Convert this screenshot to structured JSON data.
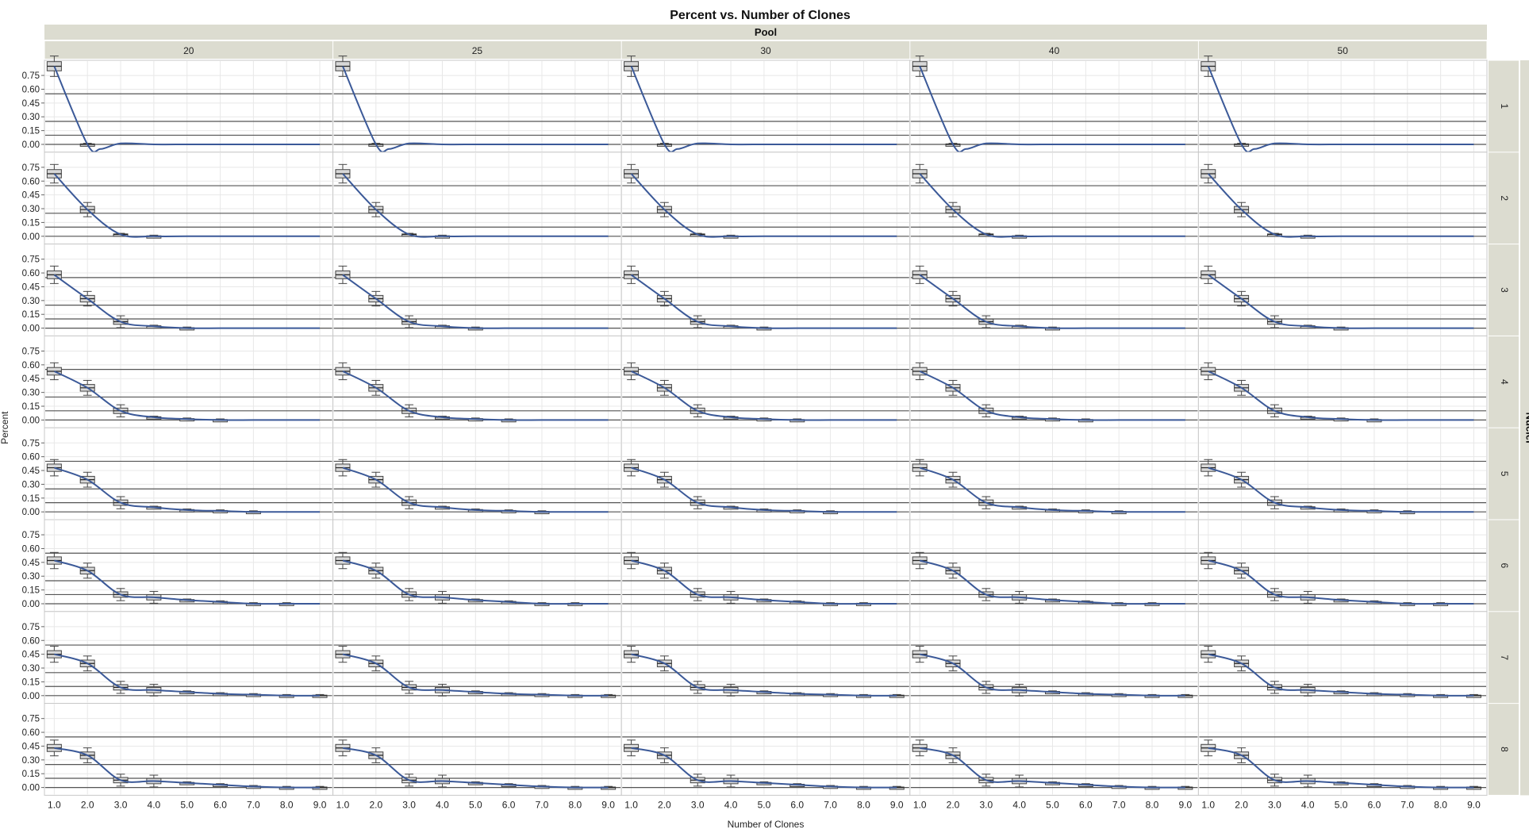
{
  "chart_data": {
    "type": "line",
    "title": "Percent vs. Number of Clones",
    "xlabel": "Number of Clones",
    "ylabel": "Percent",
    "column_group_label": "Pool",
    "row_group_label": "Nuclei",
    "columns": [
      "20",
      "25",
      "30",
      "40",
      "50"
    ],
    "rows": [
      "1",
      "2",
      "3",
      "4",
      "5",
      "6",
      "7",
      "8"
    ],
    "x_ticks": [
      "1.0",
      "2.0",
      "3.0",
      "4.0",
      "5.0",
      "6.0",
      "7.0",
      "8.0",
      "9.0"
    ],
    "y_ticks": [
      "0.00",
      "0.15",
      "0.30",
      "0.45",
      "0.60",
      "0.75"
    ],
    "xlim": [
      0.8,
      9.3
    ],
    "ylim": [
      -0.05,
      0.88
    ],
    "reference_lines_y": [
      0.0,
      0.1,
      0.25,
      0.55
    ],
    "grid": true,
    "colors": {
      "curve": "#3b5998",
      "box": "#888888",
      "header_bg": "#dcdcd0",
      "grid": "#e8e8e8",
      "reference": "#555555"
    },
    "x": [
      1,
      2,
      3,
      4,
      5,
      6,
      7,
      8,
      9
    ],
    "series_by_nuclei": [
      {
        "nuclei": "1",
        "values": [
          0.85,
          0.0,
          0.0,
          0.0,
          0.0,
          0.0,
          0.0,
          0.0,
          0.0
        ]
      },
      {
        "nuclei": "2",
        "values": [
          0.68,
          0.29,
          0.02,
          0.0,
          0.0,
          0.0,
          0.0,
          0.0,
          0.0
        ]
      },
      {
        "nuclei": "3",
        "values": [
          0.58,
          0.32,
          0.07,
          0.02,
          0.0,
          0.0,
          0.0,
          0.0,
          0.0
        ]
      },
      {
        "nuclei": "4",
        "values": [
          0.53,
          0.35,
          0.1,
          0.03,
          0.01,
          0.0,
          0.0,
          0.0,
          0.0
        ]
      },
      {
        "nuclei": "5",
        "values": [
          0.48,
          0.35,
          0.1,
          0.05,
          0.02,
          0.01,
          0.0,
          0.0,
          0.0
        ]
      },
      {
        "nuclei": "6",
        "values": [
          0.47,
          0.36,
          0.1,
          0.07,
          0.04,
          0.02,
          0.0,
          0.0,
          0.0
        ]
      },
      {
        "nuclei": "7",
        "values": [
          0.45,
          0.35,
          0.09,
          0.06,
          0.04,
          0.02,
          0.01,
          0.0,
          0.0
        ]
      },
      {
        "nuclei": "8",
        "values": [
          0.43,
          0.35,
          0.08,
          0.07,
          0.05,
          0.03,
          0.01,
          0.0,
          0.0
        ]
      }
    ]
  }
}
